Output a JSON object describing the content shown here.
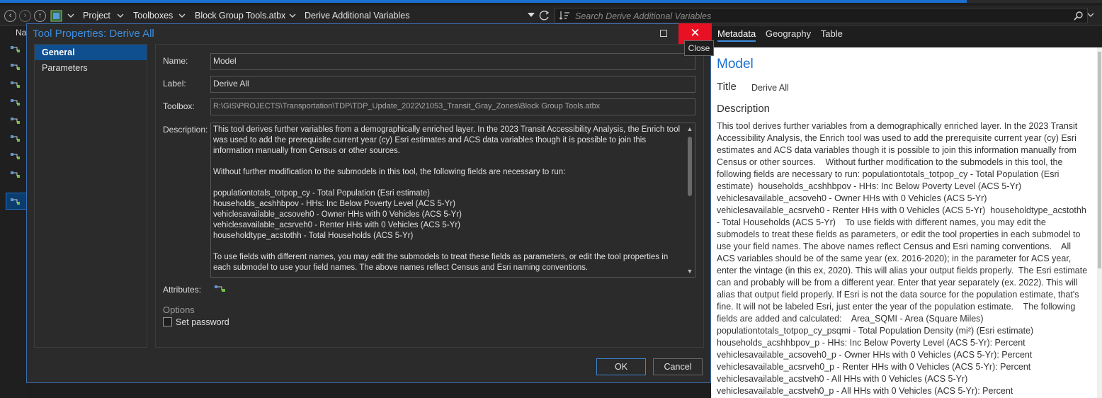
{
  "navbar": {
    "crumbs": [
      "Project",
      "Toolboxes",
      "Block Group Tools.atbx",
      "Derive Additional Variables"
    ],
    "search_placeholder": "Search Derive Additional Variables"
  },
  "left_panel": {
    "header_partial": "Na"
  },
  "dialog": {
    "title": "Tool Properties: Derive All",
    "close_symbol": "✕",
    "close_tooltip": "Close",
    "nav": [
      {
        "label": "General",
        "active": true
      },
      {
        "label": "Parameters",
        "active": false
      }
    ],
    "labels": {
      "name": "Name:",
      "label": "Label:",
      "toolbox": "Toolbox:",
      "description": "Description:",
      "attributes": "Attributes:",
      "options": "Options",
      "set_password": "Set password"
    },
    "name_value": "Model",
    "label_value": "Derive All",
    "toolbox_value": "R:\\GIS\\PROJECTS\\Transportation\\TDP\\TDP_Update_2022\\21053_Transit_Gray_Zones\\Block Group Tools.atbx",
    "description_value": "This tool derives further variables from a demographically enriched layer. In the 2023 Transit Accessibility Analysis, the Enrich tool was used to add the prerequisite current year (cy) Esri estimates and ACS data variables though it is possible to join this information manually from Census or other sources.\n\nWithout further modification to the submodels in this tool, the following fields are necessary to run:\n\npopulationtotals_totpop_cy - Total Population (Esri estimate)\nhouseholds_acshhbpov - HHs: Inc Below Poverty Level (ACS 5-Yr)\nvehiclesavailable_acsoveh0 - Owner HHs with 0 Vehicles (ACS 5-Yr)\nvehiclesavailable_acsrveh0 - Renter HHs with 0 Vehicles (ACS 5-Yr)\nhouseholdtype_acstothh - Total Households (ACS 5-Yr)\n\nTo use fields with different names, you may edit the submodels to treat these fields as parameters, or edit the tool properties in each submodel to use your field names. The above names reflect Census and Esri naming conventions.",
    "set_password_checked": false,
    "ok_label": "OK",
    "cancel_label": "Cancel"
  },
  "metadata": {
    "tabs": [
      {
        "label": "Metadata",
        "active": true
      },
      {
        "label": "Geography",
        "active": false
      },
      {
        "label": "Table",
        "active": false
      }
    ],
    "heading": "Model",
    "title_label": "Title",
    "title_value": "Derive All",
    "description_label": "Description",
    "description_text": "This tool derives further variables from a demographically enriched layer. In the 2023 Transit Accessibility Analysis, the Enrich tool was used to add the prerequisite current year (cy) Esri estimates and ACS data variables though it is possible to join this information manually from Census or other sources.    Without further modification to the submodels in this tool, the following fields are necessary to run: populationtotals_totpop_cy - Total Population (Esri estimate)  households_acshhbpov - HHs: Inc Below Poverty Level (ACS 5-Yr)  vehiclesavailable_acsoveh0 - Owner HHs with 0 Vehicles (ACS 5-Yr)   vehiclesavailable_acsrveh0 - Renter HHs with 0 Vehicles (ACS 5-Yr)  householdtype_acstothh - Total Households (ACS 5-Yr)    To use fields with different names, you may edit the submodels to treat these fields as parameters, or edit the tool properties in each submodel to use your field names. The above names reflect Census and Esri naming conventions.    All ACS variables should be of the same year (ex. 2016-2020); in the parameter for ACS year, enter the vintage (in this ex, 2020). This will alias your output fields properly.  The Esri estimate can and probably will be from a different year. Enter that year separately (ex. 2022). This will alias that output field properly. If Esri is not the data source for the population estimate, that's fine. It will not be labeled Esri, just enter the year of the population estimate.    The following fields are added and calculated:    Area_SQMI - Area (Square Miles)  populationtotals_totpop_cy_psqmi - Total Population Density (mi²) (Esri estimate)  households_acshhbpov_p - HHs: Inc Below Poverty Level (ACS 5-Yr): Percent  vehiclesavailable_acsoveh0_p - Owner HHs with 0 Vehicles (ACS 5-Yr): Percent  vehiclesavailable_acsrveh0_p - Renter HHs with 0 Vehicles (ACS 5-Yr): Percent  vehiclesavailable_acstveh0 - All HHs with 0 Vehicles (ACS 5-Yr)  vehiclesavailable_acstveh0_p - All HHs with 0 Vehicles (ACS 5-Yr): Percent"
  },
  "colors": {
    "accent": "#1a6fd1",
    "close_red": "#e81123",
    "nav_active": "#0f4f8f"
  }
}
